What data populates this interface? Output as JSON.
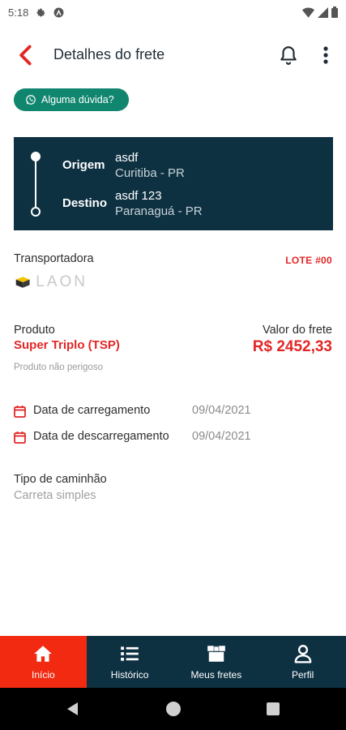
{
  "status_bar": {
    "time": "5:18"
  },
  "header": {
    "title": "Detalhes do frete"
  },
  "help": {
    "label": "Alguma dúvida?"
  },
  "route": {
    "origin_label": "Origem",
    "origin_name": "asdf",
    "origin_city": "Curitiba - PR",
    "destination_label": "Destino",
    "destination_name": "asdf 123",
    "destination_city": "Paranaguá - PR"
  },
  "carrier": {
    "label": "Transportadora",
    "lot": "LOTE #00",
    "logo_text": "LAON"
  },
  "product": {
    "label": "Produto",
    "name": "Super Triplo (TSP)",
    "note": "Produto não perigoso"
  },
  "freight": {
    "label": "Valor do frete",
    "value": "R$ 2452,33"
  },
  "dates": [
    {
      "label": "Data de carregamento",
      "value": "09/04/2021"
    },
    {
      "label": "Data de descarregamento",
      "value": "09/04/2021"
    }
  ],
  "truck": {
    "label": "Tipo de caminhão",
    "value": "Carreta simples"
  },
  "bottom_nav": [
    {
      "label": "Início",
      "icon": "home-icon",
      "active": true
    },
    {
      "label": "Histórico",
      "icon": "list-icon",
      "active": false
    },
    {
      "label": "Meus fretes",
      "icon": "box-icon",
      "active": false
    },
    {
      "label": "Perfil",
      "icon": "person-icon",
      "active": false
    }
  ],
  "colors": {
    "accent": "#e32626",
    "primary": "#0e3142",
    "whatsapp": "#10866f",
    "active_tab": "#f22a12"
  }
}
